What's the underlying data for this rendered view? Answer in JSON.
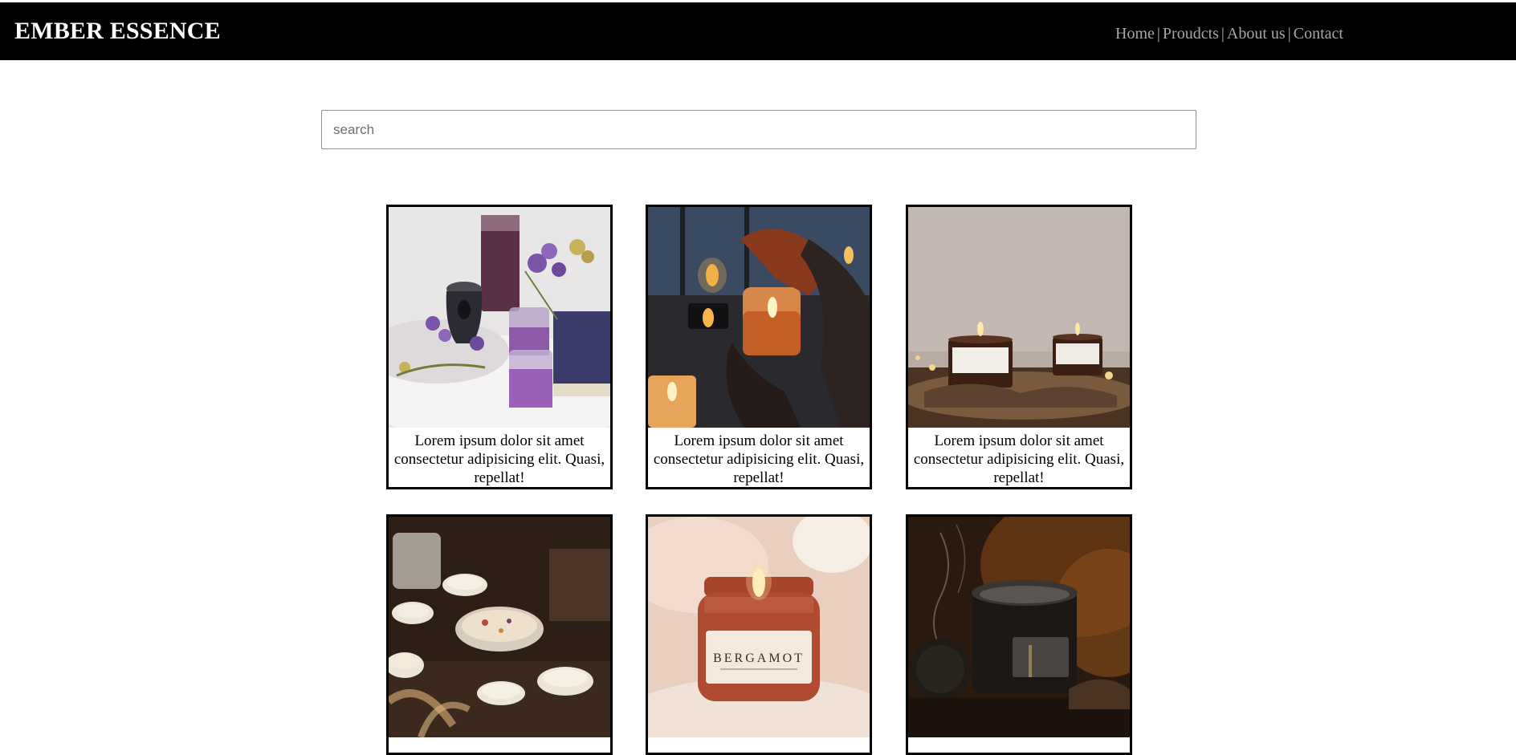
{
  "header": {
    "brand": "EMBER ESSENCE",
    "nav": [
      {
        "label": "Home"
      },
      {
        "label": "Proudcts"
      },
      {
        "label": "About us"
      },
      {
        "label": "Contact"
      }
    ],
    "separator": "|"
  },
  "search": {
    "placeholder": "search",
    "value": ""
  },
  "products": [
    {
      "caption": "Lorem ipsum dolor sit amet consectetur adipisicing elit. Quasi, repellat!",
      "image": "candle-lavender-photo"
    },
    {
      "caption": "Lorem ipsum dolor sit amet consectetur adipisicing elit. Quasi, repellat!",
      "image": "candle-hand-photo"
    },
    {
      "caption": "Lorem ipsum dolor sit amet consectetur adipisicing elit. Quasi, repellat!",
      "image": "amber-jar-candles-photo"
    },
    {
      "caption": "",
      "image": "floral-candles-photo"
    },
    {
      "caption": "",
      "image": "bergamot-candle-photo",
      "label_text": "BERGAMOT"
    },
    {
      "caption": "",
      "image": "smoked-glass-candle-photo"
    }
  ],
  "colors": {
    "header_bg": "#000000",
    "brand_text": "#ffffff",
    "nav_text": "#a7a7a7",
    "card_border": "#000000"
  }
}
